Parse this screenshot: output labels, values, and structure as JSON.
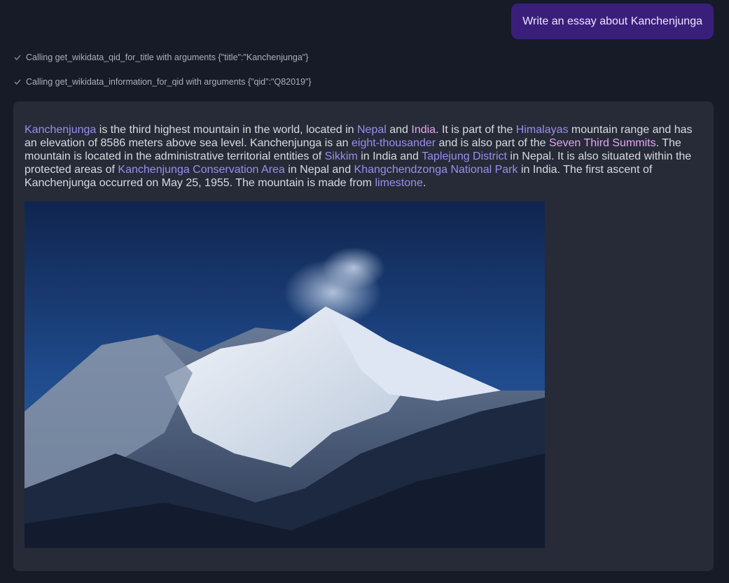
{
  "user_message": "Write an essay about Kanchenjunga",
  "tool_calls": [
    {
      "text": "Calling get_wikidata_qid_for_title with arguments {\"title\":\"Kanchenjunga\"}",
      "icon": "check-icon"
    },
    {
      "text": "Calling get_wikidata_information_for_qid with arguments {\"qid\":\"Q82019\"}",
      "icon": "check-icon"
    }
  ],
  "essay": {
    "segments": [
      {
        "text": "Kanchenjunga",
        "link": true
      },
      {
        "text": " is the third highest mountain in the world, located in "
      },
      {
        "text": "Nepal",
        "link": true
      },
      {
        "text": " and "
      },
      {
        "text": "India",
        "link": true,
        "visited": true
      },
      {
        "text": ". It is part of the "
      },
      {
        "text": "Himalayas",
        "link": true
      },
      {
        "text": " mountain range and has an elevation of 8586 meters above sea level. Kanchenjunga is an "
      },
      {
        "text": "eight-thousander",
        "link": true
      },
      {
        "text": " and is also part of the "
      },
      {
        "text": "Seven Third Summits",
        "link": true,
        "visited": true
      },
      {
        "text": ". The mountain is located in the administrative territorial entities of "
      },
      {
        "text": "Sikkim",
        "link": true
      },
      {
        "text": " in India and "
      },
      {
        "text": "Taplejung District",
        "link": true
      },
      {
        "text": " in Nepal. It is also situated within the protected areas of "
      },
      {
        "text": "Kanchenjunga Conservation Area",
        "link": true
      },
      {
        "text": " in Nepal and "
      },
      {
        "text": "Khangchendzonga National Park",
        "link": true
      },
      {
        "text": " in India. The first ascent of Kanchenjunga occurred on May 25, 1955. The mountain is made from "
      },
      {
        "text": "limestone",
        "link": true
      },
      {
        "text": "."
      }
    ]
  },
  "image": {
    "subject": "Kanchenjunga mountain photo"
  },
  "colors": {
    "background": "#161b27",
    "card": "#262b37",
    "user_bubble": "#3a1f7a",
    "link": "#9d8cf2",
    "link_visited": "#e3a6f0"
  }
}
